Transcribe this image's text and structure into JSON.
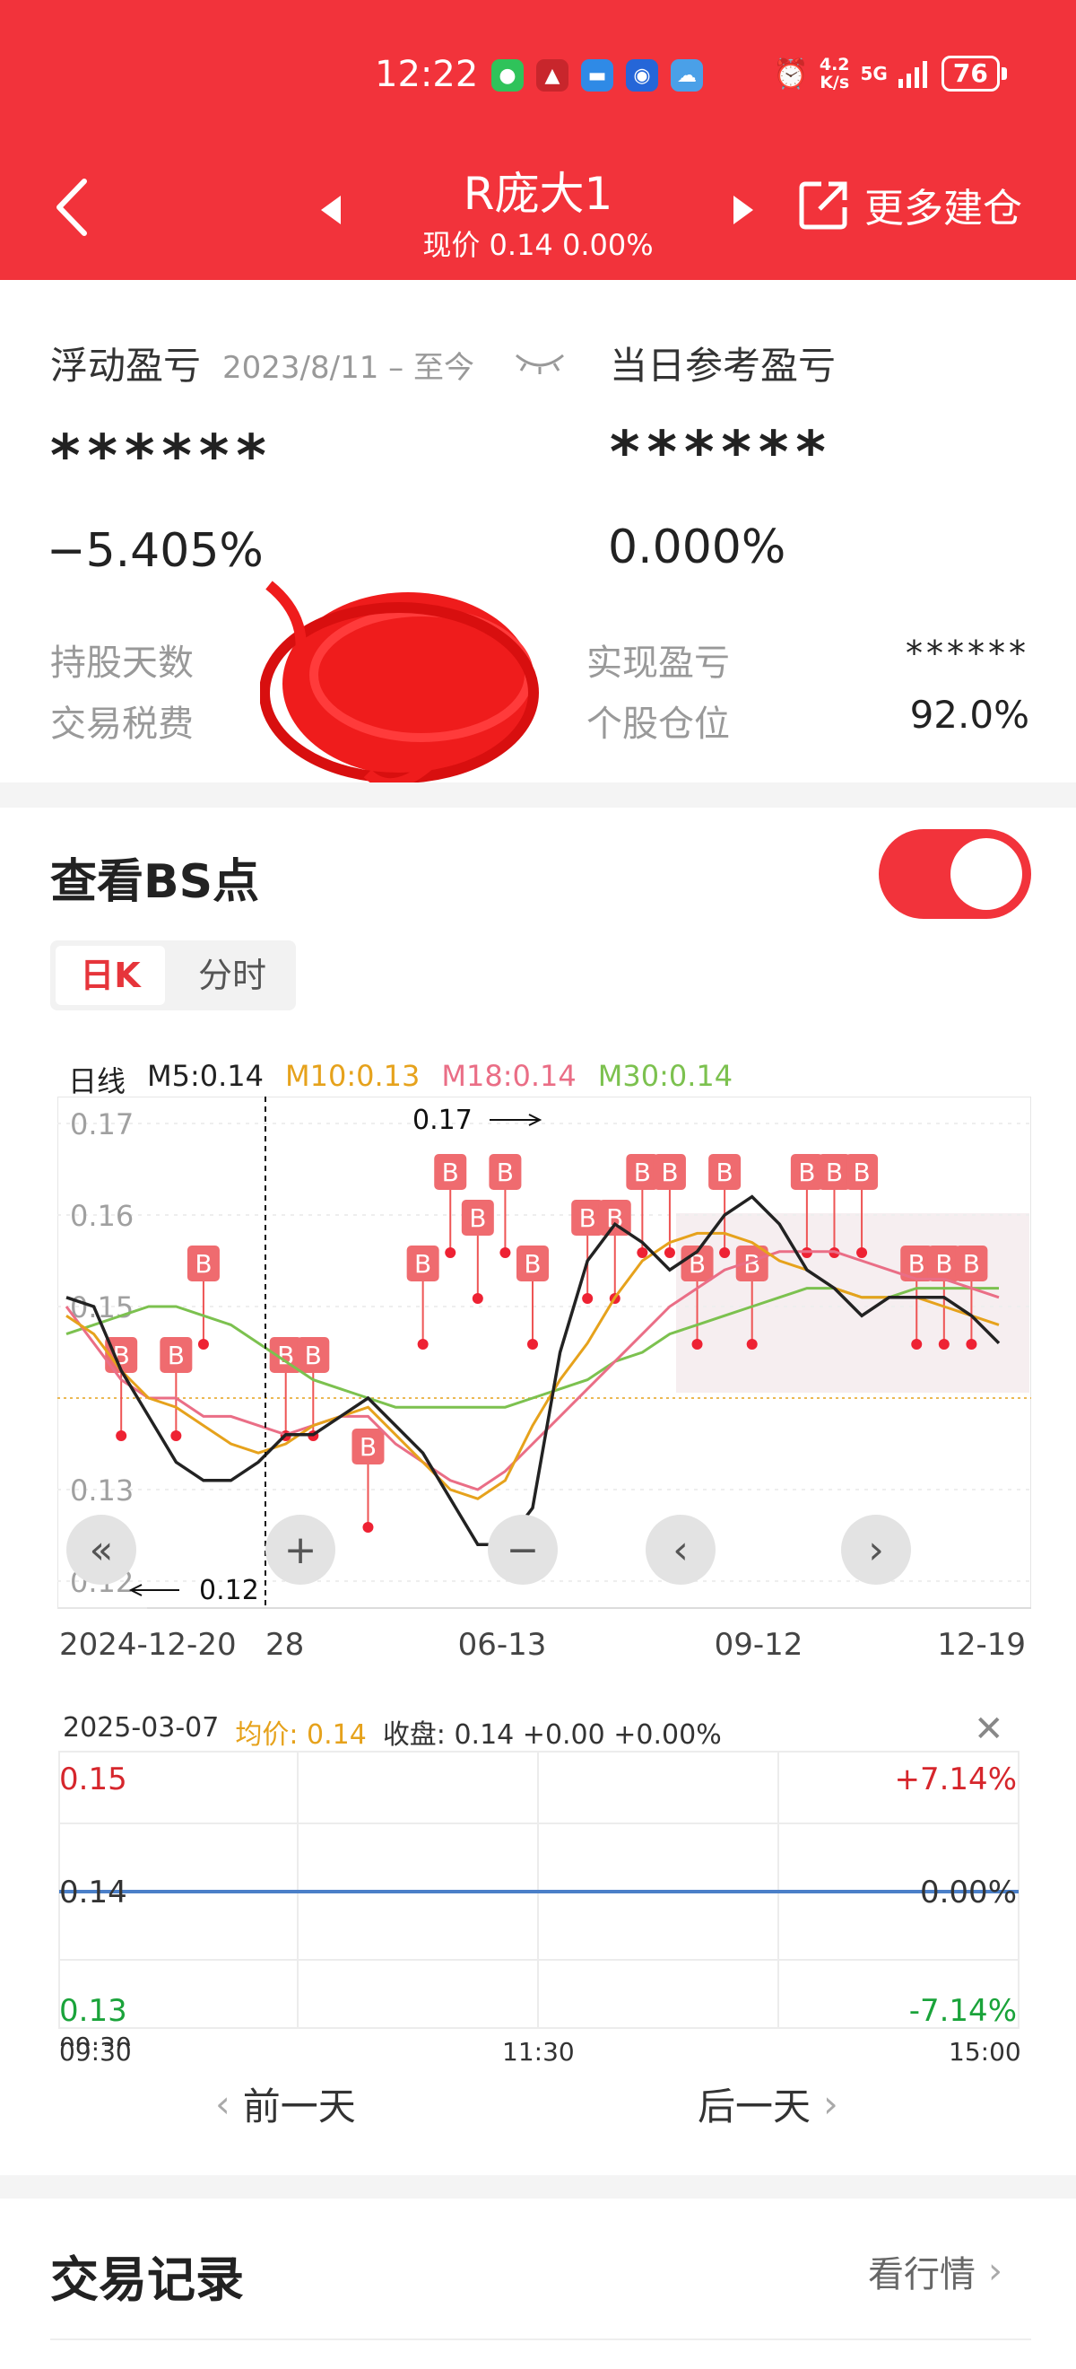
{
  "status_bar": {
    "time": "12:22",
    "net_speed_value": "4.2",
    "net_speed_unit": "K/s",
    "network": "5G",
    "battery": "76",
    "app_icons": [
      "wechat-icon",
      "stock-app-icon",
      "message-icon",
      "lightbulb-icon",
      "weather-icon"
    ]
  },
  "header": {
    "stock_name": "R庞大1",
    "price_line": "现价 0.14 0.00%",
    "more_label": "更多建仓"
  },
  "summary": {
    "float_pl_label": "浮动盈亏",
    "date_range": "2023/8/11 – 至今",
    "daily_ref_label": "当日参考盈亏",
    "float_pl_value": "******",
    "daily_ref_value": "******",
    "float_pl_pct": "−5.405%",
    "daily_ref_pct": "0.000%",
    "hold_days_label": "持股天数",
    "tax_fee_label": "交易税费",
    "realized_label": "实现盈亏",
    "realized_value": "******",
    "position_label": "个股仓位",
    "position_value": "92.0%"
  },
  "bs": {
    "title": "查看BS点",
    "toggle_on": true,
    "tab_day": "日K",
    "tab_minute": "分时",
    "accent": "#f2333b"
  },
  "ma": {
    "line_label": "日线",
    "m5": "M5:0.14",
    "m10": "M10:0.13",
    "m18": "M18:0.14",
    "m30": "M30:0.14",
    "colors": {
      "m5": "#222222",
      "m10": "#e6a21c",
      "m18": "#ea6e86",
      "m30": "#7cc14f"
    }
  },
  "chart_data": {
    "type": "line",
    "ylim": [
      0.12,
      0.17
    ],
    "yticks": [
      "0.17",
      "0.16",
      "0.15",
      "0.13",
      "0.12"
    ],
    "x_labels": [
      "2024-12-20",
      "28",
      "06-13",
      "09-12",
      "12-19"
    ],
    "max_annotation": "0.17",
    "min_annotation": "0.12",
    "buy_marker_label": "B",
    "series": [
      {
        "key": "m5",
        "values": [
          0.151,
          0.15,
          0.143,
          0.138,
          0.133,
          0.131,
          0.131,
          0.133,
          0.136,
          0.136,
          0.138,
          0.14,
          0.137,
          0.134,
          0.129,
          0.124,
          0.124,
          0.128,
          0.145,
          0.155,
          0.159,
          0.157,
          0.154,
          0.156,
          0.16,
          0.162,
          0.159,
          0.154,
          0.152,
          0.149,
          0.151,
          0.151,
          0.151,
          0.149,
          0.146
        ]
      },
      {
        "key": "m10",
        "values": [
          0.149,
          0.147,
          0.143,
          0.14,
          0.139,
          0.137,
          0.135,
          0.134,
          0.135,
          0.137,
          0.138,
          0.139,
          0.136,
          0.133,
          0.13,
          0.129,
          0.131,
          0.137,
          0.142,
          0.146,
          0.151,
          0.155,
          0.157,
          0.158,
          0.158,
          0.157,
          0.155,
          0.154,
          0.152,
          0.151,
          0.151,
          0.151,
          0.15,
          0.149,
          0.148
        ]
      },
      {
        "key": "m18",
        "values": [
          0.15,
          0.146,
          0.142,
          0.14,
          0.14,
          0.138,
          0.138,
          0.137,
          0.136,
          0.137,
          0.138,
          0.138,
          0.135,
          0.133,
          0.131,
          0.13,
          0.132,
          0.135,
          0.138,
          0.141,
          0.144,
          0.147,
          0.15,
          0.152,
          0.154,
          0.155,
          0.156,
          0.156,
          0.156,
          0.155,
          0.154,
          0.153,
          0.153,
          0.152,
          0.151
        ]
      },
      {
        "key": "m30",
        "values": [
          0.147,
          0.148,
          0.149,
          0.15,
          0.15,
          0.149,
          0.148,
          0.146,
          0.144,
          0.142,
          0.141,
          0.14,
          0.139,
          0.139,
          0.139,
          0.139,
          0.139,
          0.14,
          0.141,
          0.142,
          0.144,
          0.145,
          0.147,
          0.148,
          0.149,
          0.15,
          0.151,
          0.152,
          0.152,
          0.151,
          0.151,
          0.152,
          0.152,
          0.152,
          0.152
        ]
      }
    ],
    "b_markers": [
      {
        "i": 2,
        "v": 0.14
      },
      {
        "i": 4,
        "v": 0.14
      },
      {
        "i": 5,
        "v": 0.15
      },
      {
        "i": 8,
        "v": 0.14
      },
      {
        "i": 9,
        "v": 0.14
      },
      {
        "i": 11,
        "v": 0.13
      },
      {
        "i": 13,
        "v": 0.15
      },
      {
        "i": 14,
        "v": 0.16
      },
      {
        "i": 15,
        "v": 0.155
      },
      {
        "i": 16,
        "v": 0.16
      },
      {
        "i": 17,
        "v": 0.15
      },
      {
        "i": 19,
        "v": 0.155
      },
      {
        "i": 20,
        "v": 0.155
      },
      {
        "i": 21,
        "v": 0.16
      },
      {
        "i": 22,
        "v": 0.16
      },
      {
        "i": 23,
        "v": 0.15
      },
      {
        "i": 24,
        "v": 0.16
      },
      {
        "i": 25,
        "v": 0.15
      },
      {
        "i": 27,
        "v": 0.16
      },
      {
        "i": 28,
        "v": 0.16
      },
      {
        "i": 29,
        "v": 0.16
      },
      {
        "i": 31,
        "v": 0.15
      },
      {
        "i": 32,
        "v": 0.15
      },
      {
        "i": 33,
        "v": 0.15
      }
    ]
  },
  "intraday": {
    "date": "2025-03-07",
    "avg_label": "均价:",
    "avg_value": "0.14",
    "close_label": "收盘:",
    "close_value": "0.14 +0.00 +0.00%",
    "y_high": "0.15",
    "y_mid": "0.14",
    "y_low": "0.13",
    "pct_high": "+7.14%",
    "pct_mid": "0.00%",
    "pct_low": "-7.14%",
    "t_start": "09:30",
    "t_mid": "11:30",
    "t_end": "15:00",
    "price": 0.14,
    "line_color": "#4a7fc8"
  },
  "day_nav": {
    "prev": "前一天",
    "next": "后一天"
  },
  "trades": {
    "title": "交易记录",
    "market_link": "看行情"
  }
}
